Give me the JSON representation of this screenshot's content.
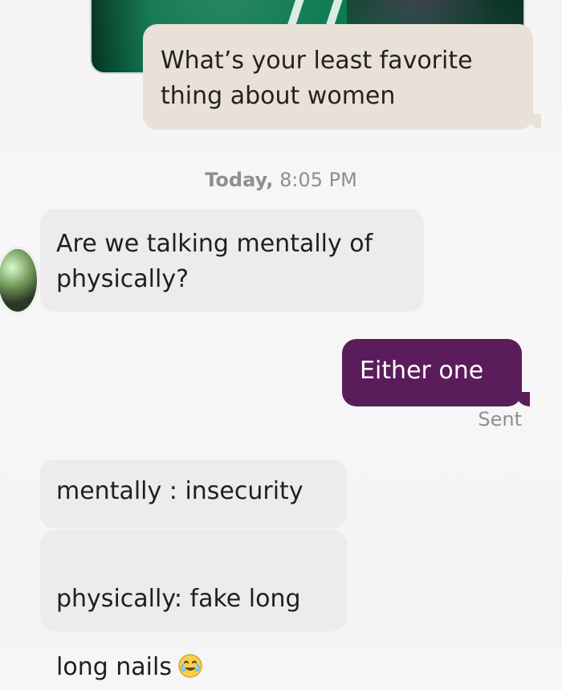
{
  "chat": {
    "messages": [
      {
        "kind": "outgoing",
        "text": "What’s your least favorite\nthing about women"
      },
      {
        "kind": "timestamp",
        "day": "Today,",
        "time": " 8:05 PM"
      },
      {
        "kind": "incoming",
        "text": "Are we talking mentally of\nphysically?"
      },
      {
        "kind": "outgoing",
        "text": "Either one"
      },
      {
        "kind": "status",
        "text": "Sent"
      },
      {
        "kind": "incoming",
        "text": "mentally : insecurity"
      },
      {
        "kind": "incoming",
        "text": "physically: fake long\nlong nails",
        "emoji": "tears-of-joy-emoji"
      }
    ],
    "colors": {
      "outgoing_top_bubble": "#e9e0d8",
      "outgoing_purple_bubble": "#5b1c5b",
      "incoming_bubble": "#ececec",
      "muted_text": "#8f8f8f"
    },
    "icons": {
      "avatar": "contact-avatar",
      "laugh": "tears-of-joy-emoji"
    }
  }
}
